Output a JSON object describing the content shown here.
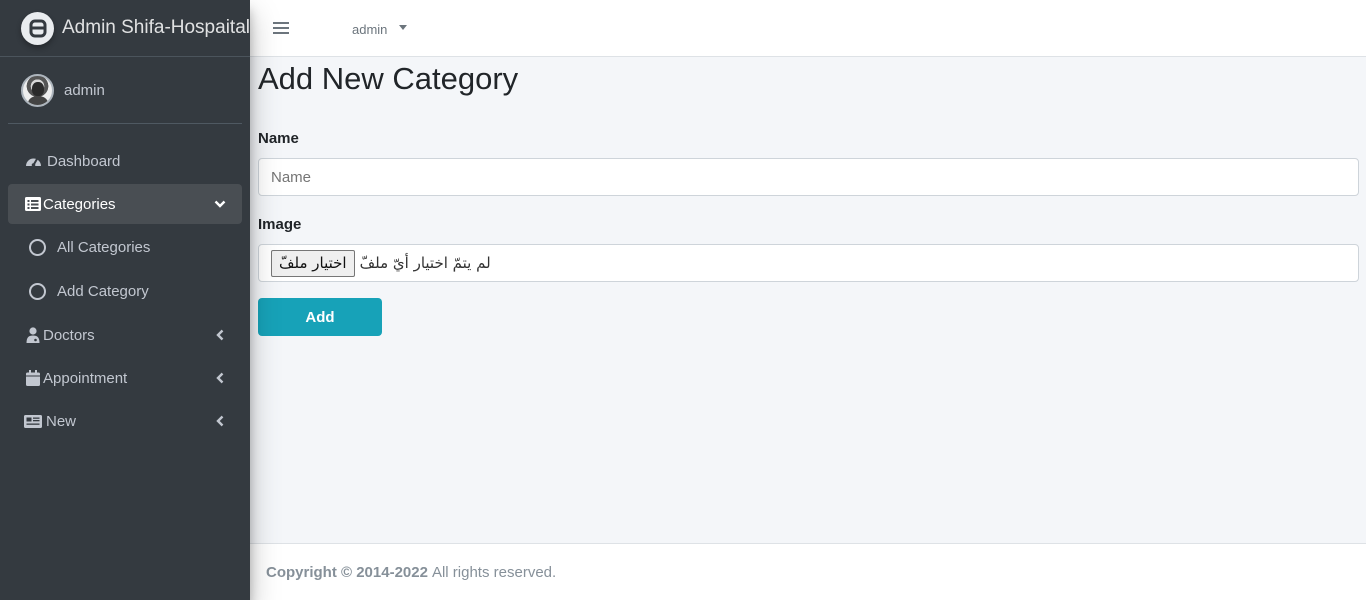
{
  "brand": {
    "title": "Admin Shifa-Hospaital",
    "logo_icon": "brand-logo-icon"
  },
  "user": {
    "name": "admin"
  },
  "sidebar": {
    "items": [
      {
        "label": "Dashboard",
        "icon": "tachometer-icon"
      },
      {
        "label": "Categories",
        "icon": "list-icon",
        "expanded": true
      },
      {
        "label": "Doctors",
        "icon": "user-md-icon"
      },
      {
        "label": "Appointment",
        "icon": "calendar-icon"
      },
      {
        "label": "New",
        "icon": "newspaper-icon"
      }
    ],
    "sub_items": [
      {
        "label": "All Categories"
      },
      {
        "label": "Add Category"
      }
    ]
  },
  "navbar": {
    "user_label": "admin"
  },
  "main": {
    "title": "Add New Category",
    "name_label": "Name",
    "name_placeholder": "Name",
    "image_label": "Image",
    "file_button": "اختيار ملفّ",
    "file_status": "لم يتمّ اختيار أيّ ملفّ",
    "add_button": "Add"
  },
  "footer": {
    "copyright": "Copyright © 2014-2022",
    "rights": "All rights reserved."
  },
  "colors": {
    "sidebar_bg": "#343a40",
    "accent": "#17a2b8",
    "active_bg": "#494e53"
  }
}
